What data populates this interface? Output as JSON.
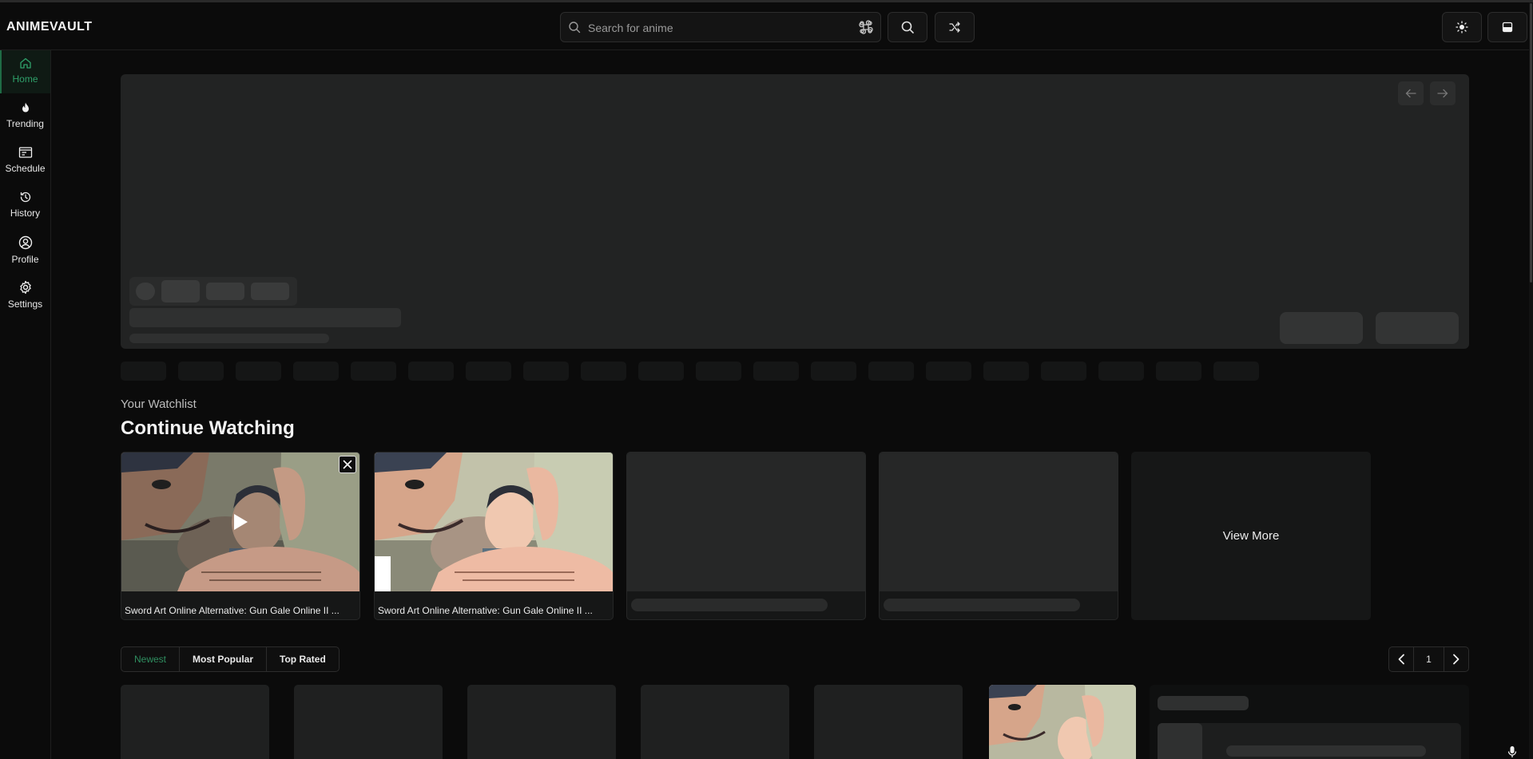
{
  "app": {
    "logo": "ANIMEVAULT"
  },
  "header": {
    "search_placeholder": "Search for anime",
    "icons": [
      "search-icon",
      "command-icon",
      "magnifier-icon",
      "shuffle-icon",
      "sun-icon",
      "panel-icon"
    ]
  },
  "sidebar": {
    "items": [
      {
        "label": "Home",
        "icon": "home-icon",
        "active": true
      },
      {
        "label": "Trending",
        "icon": "flame-icon",
        "active": false
      },
      {
        "label": "Schedule",
        "icon": "calendar-icon",
        "active": false
      },
      {
        "label": "History",
        "icon": "history-icon",
        "active": false
      },
      {
        "label": "Profile",
        "icon": "user-circle-icon",
        "active": false
      },
      {
        "label": "Settings",
        "icon": "gear-icon",
        "active": false
      }
    ]
  },
  "watchlist": {
    "subtitle": "Your Watchlist",
    "title": "Continue Watching",
    "cards": [
      {
        "title": "Sword Art Online Alternative: Gun Gale Online II ..."
      },
      {
        "title": "Sword Art Online Alternative: Gun Gale Online II ..."
      }
    ],
    "view_more": "View More"
  },
  "tabs": {
    "items": [
      {
        "label": "Newest",
        "active": true
      },
      {
        "label": "Most Popular",
        "active": false
      },
      {
        "label": "Top Rated",
        "active": false
      }
    ]
  },
  "pager": {
    "page": "1"
  },
  "colors": {
    "accent": "#2fa06a",
    "background": "#0b0b0b",
    "skeleton": "#2f3030"
  }
}
